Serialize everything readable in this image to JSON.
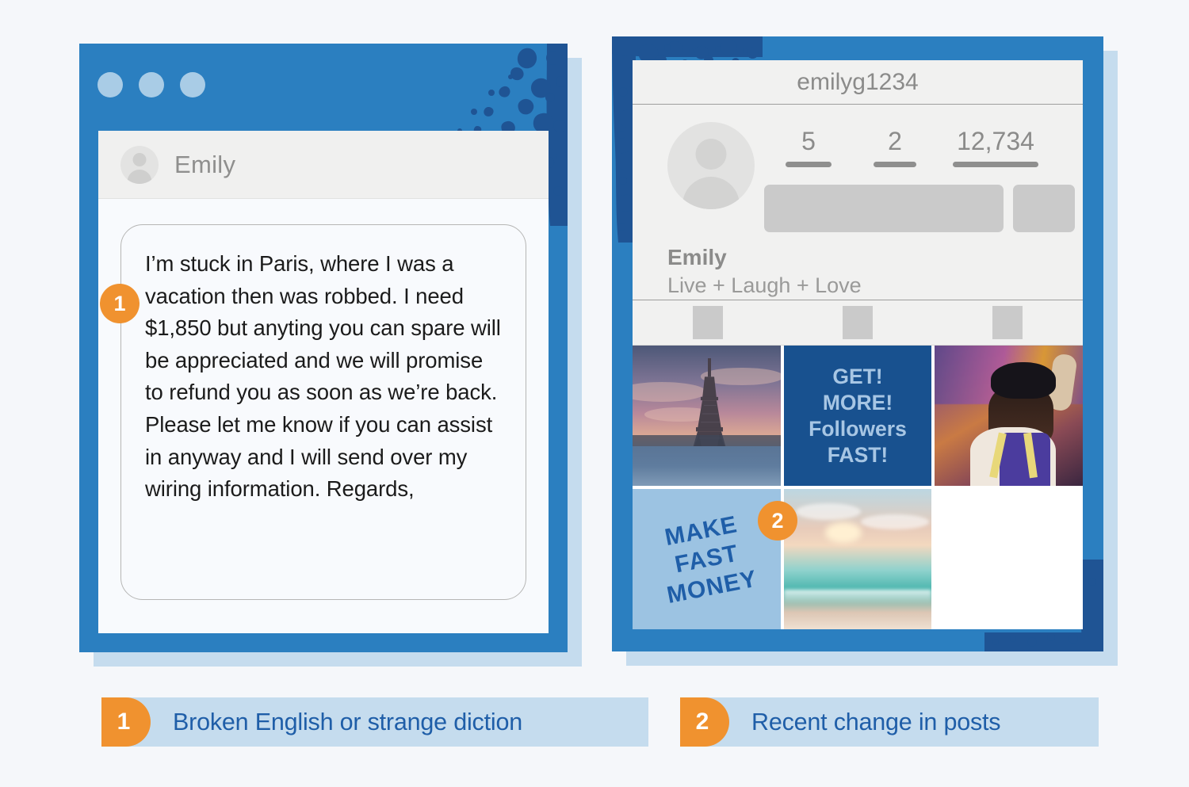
{
  "colors": {
    "frame_blue": "#2b7fc0",
    "frame_shadow": "#c5dcee",
    "splatter_dark": "#1f5494",
    "accent_orange": "#f0922f",
    "caption_bg": "#c5dcee",
    "caption_text": "#1f5ea8",
    "ad_navy": "#18518f",
    "ad_text": "#a7c6e4",
    "money_bg": "#9cc3e2",
    "page_bg": "#f5f7fa"
  },
  "message_window": {
    "window_dots": [
      "dot-1",
      "dot-2",
      "dot-3"
    ],
    "sender_name": "Emily",
    "avatar_icon": "person-avatar-icon",
    "message_body": "I’m stuck in Paris, where I was a vacation then was robbed. I need $1,850 but anyting you can spare will be appreciated and we will promise to refund you as soon as we’re back. Please let me know if you can assist in anyway and I will send over my wiring information. Regards,",
    "badge": "1"
  },
  "profile_window": {
    "handle": "emilyg1234",
    "avatar_icon": "person-avatar-icon",
    "stats": [
      {
        "value": "5",
        "label_bar_width": "58px"
      },
      {
        "value": "2",
        "label_bar_width": "54px"
      },
      {
        "value": "12,734",
        "label_bar_width": "108px"
      }
    ],
    "action_buttons": [
      "follow-button-placeholder",
      "more-button-placeholder"
    ],
    "display_name": "Emily",
    "bio": "Live + Laugh + Love",
    "tabs": [
      "grid-tab-placeholder",
      "tagged-tab-placeholder",
      "saved-tab-placeholder"
    ],
    "badge": "2",
    "grid_posts": [
      {
        "name": "eiffel-tower-photo",
        "type": "photo",
        "caption": ""
      },
      {
        "name": "get-more-followers-ad",
        "type": "ad",
        "caption": "GET!\nMORE!\nFollowers\nFAST!"
      },
      {
        "name": "traveler-photo",
        "type": "photo",
        "caption": ""
      },
      {
        "name": "make-fast-money-ad",
        "type": "ad",
        "caption": "MAKE\nFAST\nMONEY"
      },
      {
        "name": "beach-sunset-photo",
        "type": "photo",
        "caption": ""
      },
      {
        "name": "empty-post-slot",
        "type": "blank",
        "caption": ""
      }
    ]
  },
  "captions": [
    {
      "number": "1",
      "text": "Broken English or strange diction"
    },
    {
      "number": "2",
      "text": "Recent change in posts"
    }
  ]
}
